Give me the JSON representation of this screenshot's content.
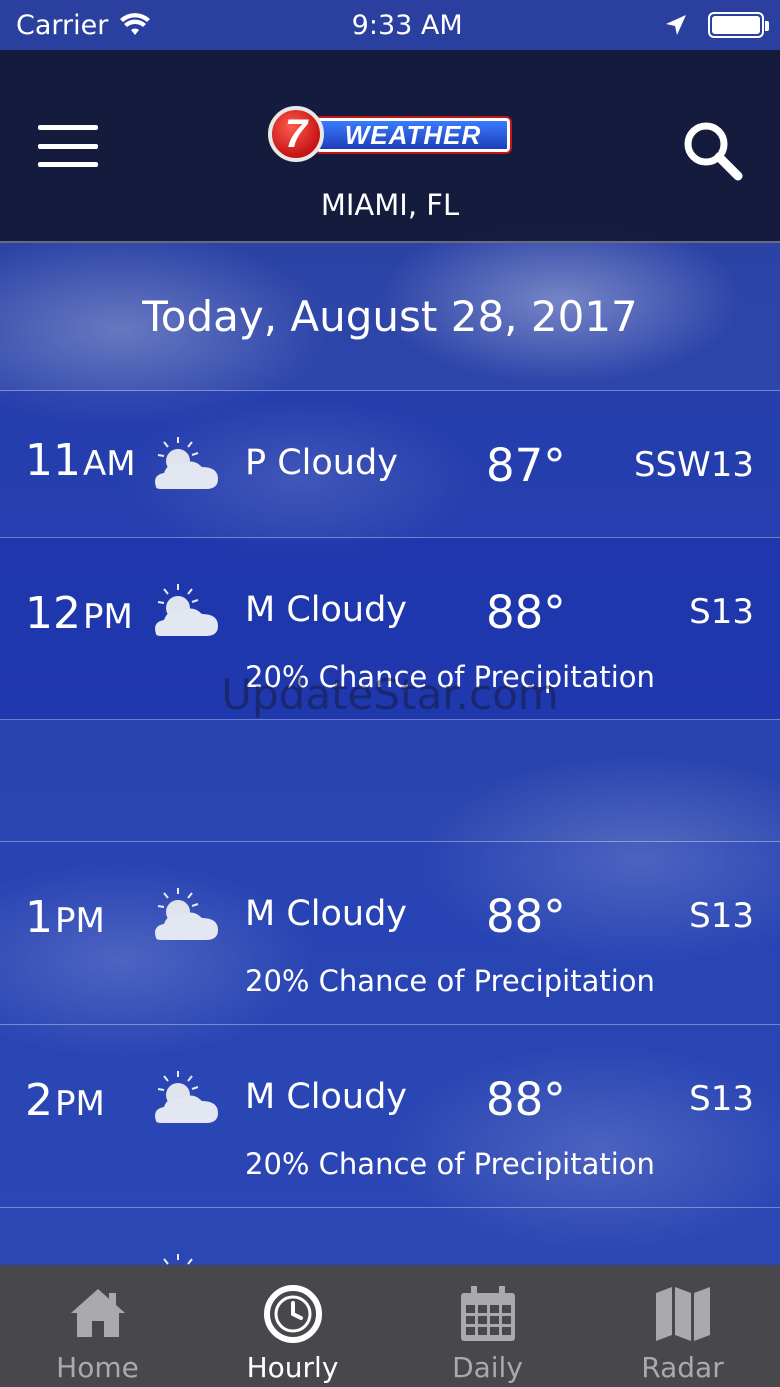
{
  "status_bar": {
    "carrier": "Carrier",
    "time": "9:33 AM",
    "icons": [
      "wifi-icon",
      "location-arrow-icon",
      "battery-icon"
    ]
  },
  "header": {
    "logo_number": "7",
    "logo_text": "WEATHER",
    "location": "MIAMI, FL",
    "icons": [
      "menu-icon",
      "search-icon"
    ]
  },
  "date_label": "Today, August 28, 2017",
  "hours": [
    {
      "time": "11",
      "ampm": "AM",
      "icon": "partly-cloudy-icon",
      "condition": "P Cloudy",
      "temp": "87°",
      "wind": "SSW13",
      "precip": ""
    },
    {
      "time": "12",
      "ampm": "PM",
      "icon": "partly-cloudy-icon",
      "condition": "M Cloudy",
      "temp": "88°",
      "wind": "S13",
      "precip": "20% Chance of Precipitation"
    },
    {
      "time": "1",
      "ampm": "PM",
      "icon": "partly-cloudy-icon",
      "condition": "M Cloudy",
      "temp": "88°",
      "wind": "S13",
      "precip": "20% Chance of Precipitation"
    },
    {
      "time": "2",
      "ampm": "PM",
      "icon": "partly-cloudy-icon",
      "condition": "M Cloudy",
      "temp": "88°",
      "wind": "S13",
      "precip": "20% Chance of Precipitation"
    }
  ],
  "watermark": "UpdateStar.com",
  "tabs": [
    {
      "label": "Home",
      "icon": "home-icon",
      "active": false
    },
    {
      "label": "Hourly",
      "icon": "clock-icon",
      "active": true
    },
    {
      "label": "Daily",
      "icon": "calendar-icon",
      "active": false
    },
    {
      "label": "Radar",
      "icon": "map-icon",
      "active": false
    }
  ],
  "colors": {
    "header_bg": "#12183a",
    "sky_blue": "#2f48b0",
    "tab_bar_bg": "#47474c",
    "tab_inactive": "#a9a9ae",
    "tab_active": "#ffffff",
    "logo_red": "#c41414",
    "logo_blue": "#1d3fb8"
  }
}
